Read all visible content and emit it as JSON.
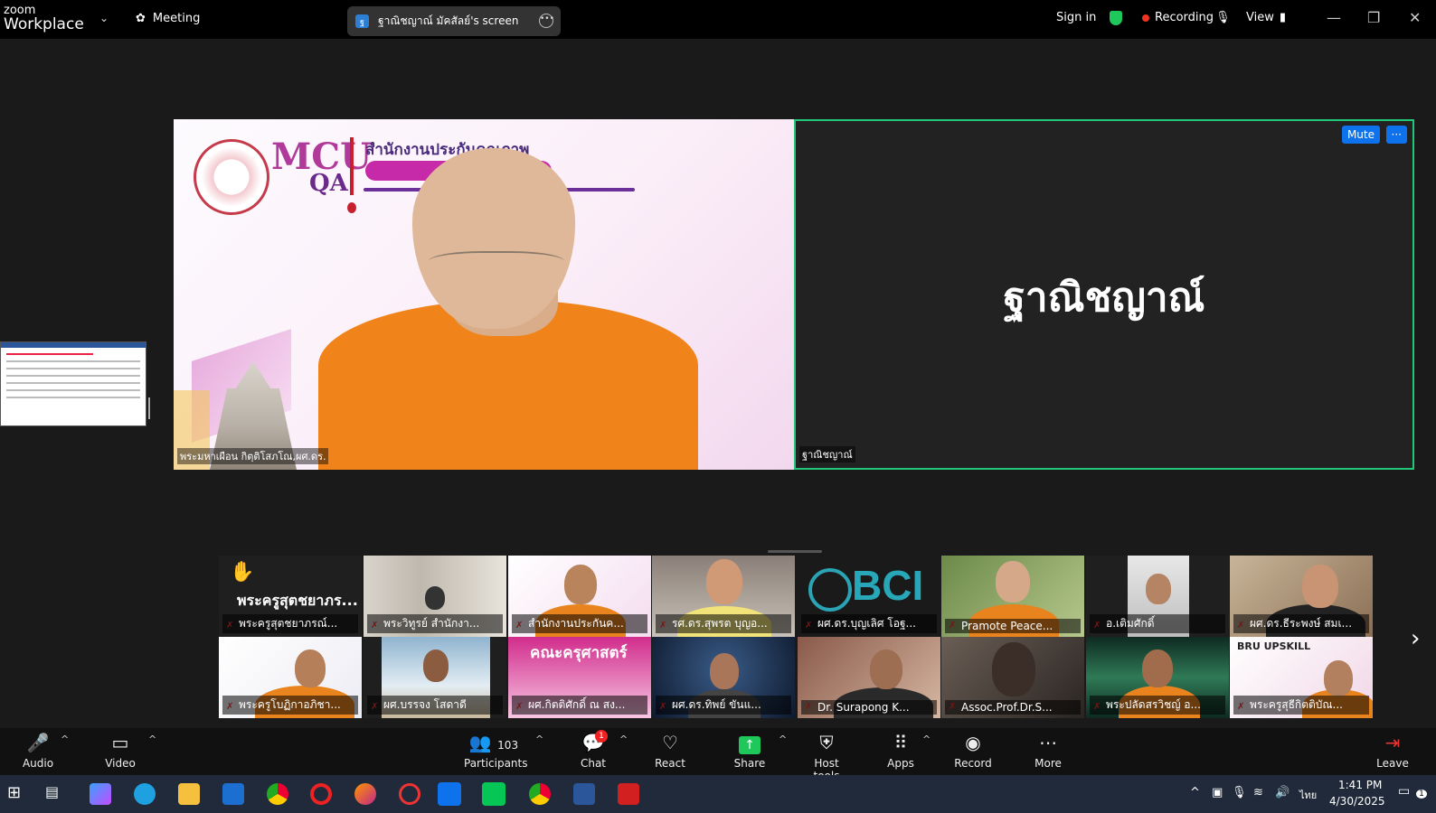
{
  "topbar": {
    "brand_top": "zoom",
    "brand_bottom": "Workplace",
    "meeting_label": "Meeting",
    "screen_share_label": "ฐาณิชญาณ์ มัคสัลย์'s screen",
    "sign_in": "Sign in",
    "recording": "Recording",
    "view": "View"
  },
  "main": {
    "left_name": "พระมหาเผือน กิตฺติโสภโณ,ผศ.ดร.",
    "slide_org": "สำนักงานประกันคุณภาพ",
    "slide_brand": "MCU",
    "slide_brand_sub": "QA",
    "right_big_name": "ฐาณิชญาณ์",
    "right_name": "ฐาณิชญาณ์",
    "mute_label": "Mute",
    "more_label": "···"
  },
  "gallery": {
    "row1": [
      {
        "label": "พระครูสุตชยาภรณ์...",
        "big": "พระครูสุตชยาภร..."
      },
      {
        "label": "พระวิทูรย์ สำนักงา..."
      },
      {
        "label": "สำนักงานประกันค..."
      },
      {
        "label": "รศ.ดร.สุพรต บุญอ..."
      },
      {
        "label": "ผศ.ดร.บุญเลิศ โอฐ...",
        "logo": "BCI"
      },
      {
        "label": "Pramote  Peace..."
      },
      {
        "label": "อ.เติมศักดิ์"
      },
      {
        "label": "ผศ.ดร.ธีระพงษ์ สมเ..."
      }
    ],
    "row2": [
      {
        "label": "พระครูโบฏิกาอภิชา..."
      },
      {
        "label": "ผศ.บรรจง โสดาดี"
      },
      {
        "label": "ผศ.กิตติศักดิ์ ณ สง...",
        "banner": "คณะครุศาสตร์"
      },
      {
        "label": "ผศ.ดร.ทิพย์ ขันแ..."
      },
      {
        "label": "Dr. Surapong K..."
      },
      {
        "label": "Assoc.Prof.Dr.S..."
      },
      {
        "label": "พระปลัดสรวิชญ์  อ..."
      },
      {
        "label": "พระครูสุธีกิตติบัณ...",
        "banner": "BRU UPSKILL"
      }
    ]
  },
  "toolbar": {
    "audio": "Audio",
    "video": "Video",
    "participants": "Participants",
    "participants_count": "103",
    "chat": "Chat",
    "chat_badge": "1",
    "react": "React",
    "share": "Share",
    "host_tools": "Host tools",
    "apps": "Apps",
    "record": "Record",
    "more": "More",
    "leave": "Leave"
  },
  "taskbar": {
    "lang": "ไทย",
    "time": "1:41 PM",
    "date": "4/30/2025",
    "notif": "1"
  },
  "colors": {
    "accent_blue": "#0e72ed",
    "active_green": "#22c87a",
    "record_red": "#ee3322"
  }
}
